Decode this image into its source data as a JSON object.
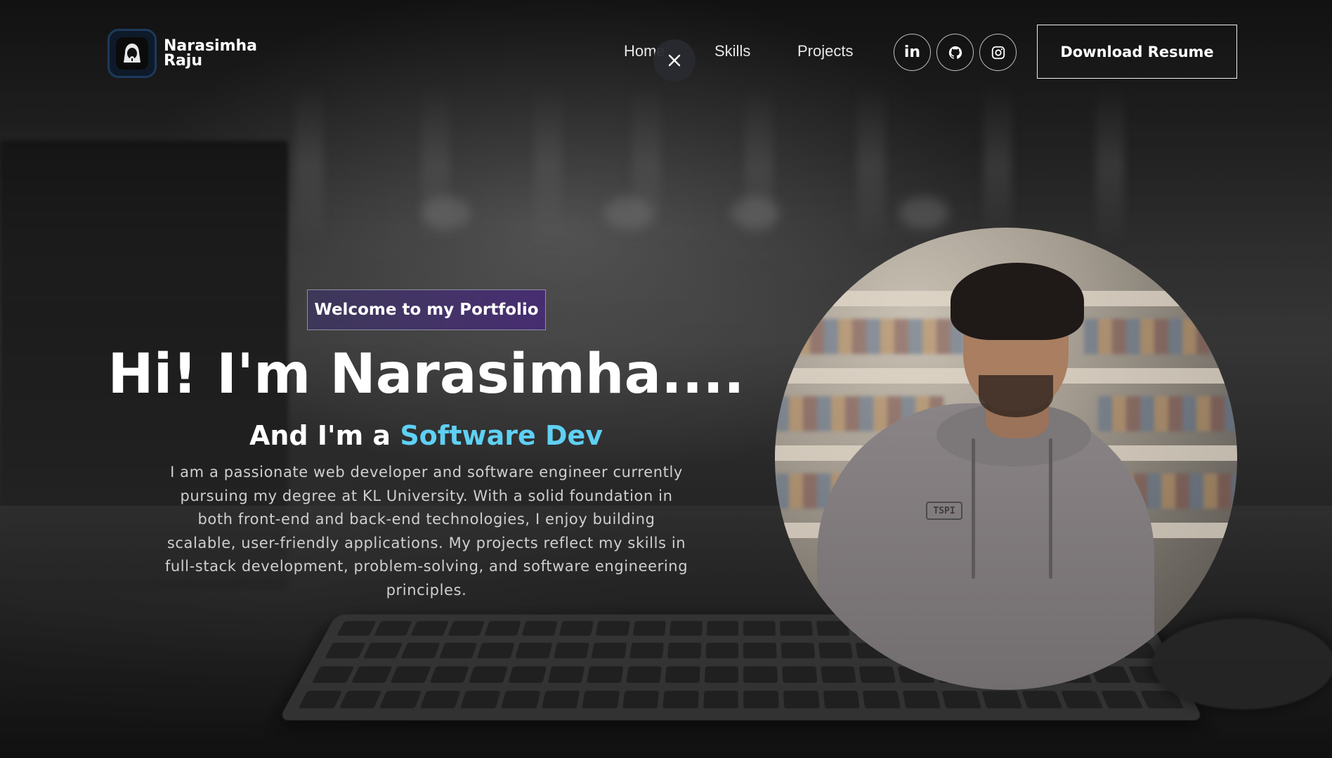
{
  "brand": {
    "name_line1": "Narasimha",
    "name_line2": "Raju",
    "logo_icon": "hacker-hood-icon"
  },
  "nav": {
    "links": [
      "Home",
      "Skills",
      "Projects"
    ],
    "close_icon": "close-icon",
    "social": [
      {
        "label": "in",
        "icon": "linkedin-icon"
      },
      {
        "label": "",
        "icon": "github-icon"
      },
      {
        "label": "",
        "icon": "instagram-icon"
      }
    ],
    "resume_label": "Download Resume"
  },
  "hero": {
    "tagline": "Welcome to my Portfolio",
    "title": "Hi! I'm Narasimha....",
    "sub_prefix": "And I'm a ",
    "sub_accent": "Software Dev",
    "description": "I am a passionate web developer and software engineer currently pursuing my degree at KL University. With a solid foundation in both front-end and back-end technologies, I enjoy building scalable, user-friendly applications. My projects reflect my skills in full-stack development, problem-solving, and software engineering principles."
  },
  "photo": {
    "hoodie_logo": "TSPI"
  },
  "colors": {
    "accent": "#5fd0f3",
    "tagline_bg": "#46287a"
  }
}
